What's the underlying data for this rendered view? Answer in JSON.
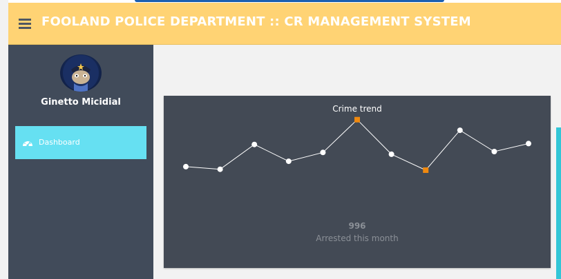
{
  "header": {
    "title": "FOOLAND POLICE DEPARTMENT :: CR MANAGEMENT SYSTEM",
    "menu_icon": "hamburger-icon"
  },
  "sidebar": {
    "user_name": "Ginetto Micidial",
    "items": [
      {
        "label": "Dashboard",
        "icon": "dashboard-gauge-icon",
        "active": true
      }
    ]
  },
  "card": {
    "stat_value": "996",
    "stat_label": "Arrested this month"
  },
  "colors": {
    "header_bg": "#ffd374",
    "sidebar_bg": "#414b5a",
    "active_item_bg": "#66e0f2",
    "card_bg": "#434a55",
    "line": "#ffffff",
    "highlight_point": "#f0890f"
  },
  "chart_data": {
    "type": "line",
    "title": "Crime trend",
    "x": [
      1,
      2,
      3,
      4,
      5,
      6,
      7,
      8,
      9,
      10,
      11
    ],
    "series": [
      {
        "values": [
          6.0,
          5.7,
          8.5,
          6.6,
          7.6,
          11.3,
          7.4,
          5.6,
          10.1,
          7.7,
          8.6
        ]
      }
    ],
    "highlighted_points": [
      6,
      8
    ],
    "ylim": [
      0,
      14
    ],
    "grid": false,
    "legend": "none"
  }
}
